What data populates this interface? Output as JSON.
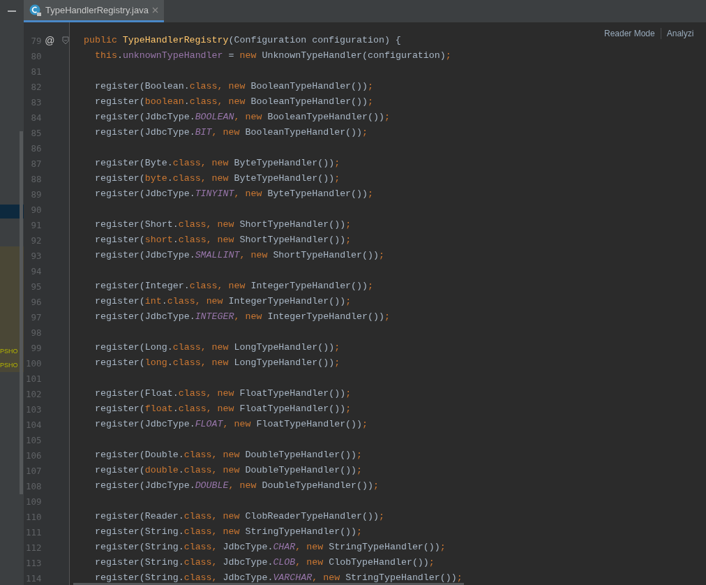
{
  "tab": {
    "title": "TypeHandlerRegistry.java",
    "selected": true
  },
  "left_panel": {
    "rows": [
      {
        "text": "PSHO"
      },
      {
        "text": "PSHO"
      }
    ]
  },
  "editor_toolbar": [
    "Reader Mode",
    "Analyzi"
  ],
  "lines": [
    {
      "number": "79",
      "kind": "signature",
      "gutter_mark": "@",
      "foldable": true,
      "tokens": [
        {
          "kind": "k",
          "text": "public"
        },
        {
          "kind": "d",
          "text": " TypeHandlerRegistry"
        },
        {
          "kind": "p",
          "text": "(Configuration configuration) {"
        }
      ]
    },
    {
      "number": "80",
      "kind": "body",
      "tokens": [
        {
          "kind": "k",
          "text": "this"
        },
        {
          "kind": "p",
          "text": "."
        },
        {
          "kind": "f",
          "text": "unknownTypeHandler"
        },
        {
          "kind": "p",
          "text": " = "
        },
        {
          "kind": "k",
          "text": "new"
        },
        {
          "kind": "p",
          "text": " UnknownTypeHandler(configuration)"
        },
        {
          "kind": "k",
          "text": ";"
        }
      ]
    },
    {
      "number": "81",
      "kind": "body"
    },
    {
      "number": "82",
      "kind": "body",
      "tokens": [
        {
          "kind": "p",
          "text": "register(Boolean."
        },
        {
          "kind": "k",
          "text": "class"
        },
        {
          "kind": "k",
          "text": ", "
        },
        {
          "kind": "k",
          "text": "new"
        },
        {
          "kind": "p",
          "text": " BooleanTypeHandler())"
        },
        {
          "kind": "k",
          "text": ";"
        }
      ]
    },
    {
      "number": "83",
      "kind": "body",
      "tokens": [
        {
          "kind": "p",
          "text": "register("
        },
        {
          "kind": "k",
          "text": "boolean"
        },
        {
          "kind": "p",
          "text": "."
        },
        {
          "kind": "k",
          "text": "class"
        },
        {
          "kind": "k",
          "text": ", "
        },
        {
          "kind": "k",
          "text": "new"
        },
        {
          "kind": "p",
          "text": " BooleanTypeHandler())"
        },
        {
          "kind": "k",
          "text": ";"
        }
      ]
    },
    {
      "number": "84",
      "kind": "body",
      "tokens": [
        {
          "kind": "p",
          "text": "register(JdbcType."
        },
        {
          "kind": "c",
          "text": "BOOLEAN"
        },
        {
          "kind": "k",
          "text": ", "
        },
        {
          "kind": "k",
          "text": "new"
        },
        {
          "kind": "p",
          "text": " BooleanTypeHandler())"
        },
        {
          "kind": "k",
          "text": ";"
        }
      ]
    },
    {
      "number": "85",
      "kind": "body",
      "tokens": [
        {
          "kind": "p",
          "text": "register(JdbcType."
        },
        {
          "kind": "c",
          "text": "BIT"
        },
        {
          "kind": "k",
          "text": ", "
        },
        {
          "kind": "k",
          "text": "new"
        },
        {
          "kind": "p",
          "text": " BooleanTypeHandler())"
        },
        {
          "kind": "k",
          "text": ";"
        }
      ]
    },
    {
      "number": "86",
      "kind": "body"
    },
    {
      "number": "87",
      "kind": "body",
      "tokens": [
        {
          "kind": "p",
          "text": "register(Byte."
        },
        {
          "kind": "k",
          "text": "class"
        },
        {
          "kind": "k",
          "text": ", "
        },
        {
          "kind": "k",
          "text": "new"
        },
        {
          "kind": "p",
          "text": " ByteTypeHandler())"
        },
        {
          "kind": "k",
          "text": ";"
        }
      ]
    },
    {
      "number": "88",
      "kind": "body",
      "tokens": [
        {
          "kind": "p",
          "text": "register("
        },
        {
          "kind": "k",
          "text": "byte"
        },
        {
          "kind": "p",
          "text": "."
        },
        {
          "kind": "k",
          "text": "class"
        },
        {
          "kind": "k",
          "text": ", "
        },
        {
          "kind": "k",
          "text": "new"
        },
        {
          "kind": "p",
          "text": " ByteTypeHandler())"
        },
        {
          "kind": "k",
          "text": ";"
        }
      ]
    },
    {
      "number": "89",
      "kind": "body",
      "tokens": [
        {
          "kind": "p",
          "text": "register(JdbcType."
        },
        {
          "kind": "c",
          "text": "TINYINT"
        },
        {
          "kind": "k",
          "text": ", "
        },
        {
          "kind": "k",
          "text": "new"
        },
        {
          "kind": "p",
          "text": " ByteTypeHandler())"
        },
        {
          "kind": "k",
          "text": ";"
        }
      ]
    },
    {
      "number": "90",
      "kind": "body"
    },
    {
      "number": "91",
      "kind": "body",
      "tokens": [
        {
          "kind": "p",
          "text": "register(Short."
        },
        {
          "kind": "k",
          "text": "class"
        },
        {
          "kind": "k",
          "text": ", "
        },
        {
          "kind": "k",
          "text": "new"
        },
        {
          "kind": "p",
          "text": " ShortTypeHandler())"
        },
        {
          "kind": "k",
          "text": ";"
        }
      ]
    },
    {
      "number": "92",
      "kind": "body",
      "tokens": [
        {
          "kind": "p",
          "text": "register("
        },
        {
          "kind": "k",
          "text": "short"
        },
        {
          "kind": "p",
          "text": "."
        },
        {
          "kind": "k",
          "text": "class"
        },
        {
          "kind": "k",
          "text": ", "
        },
        {
          "kind": "k",
          "text": "new"
        },
        {
          "kind": "p",
          "text": " ShortTypeHandler())"
        },
        {
          "kind": "k",
          "text": ";"
        }
      ]
    },
    {
      "number": "93",
      "kind": "body",
      "tokens": [
        {
          "kind": "p",
          "text": "register(JdbcType."
        },
        {
          "kind": "c",
          "text": "SMALLINT"
        },
        {
          "kind": "k",
          "text": ", "
        },
        {
          "kind": "k",
          "text": "new"
        },
        {
          "kind": "p",
          "text": " ShortTypeHandler())"
        },
        {
          "kind": "k",
          "text": ";"
        }
      ]
    },
    {
      "number": "94",
      "kind": "body"
    },
    {
      "number": "95",
      "kind": "body",
      "tokens": [
        {
          "kind": "p",
          "text": "register(Integer."
        },
        {
          "kind": "k",
          "text": "class"
        },
        {
          "kind": "k",
          "text": ", "
        },
        {
          "kind": "k",
          "text": "new"
        },
        {
          "kind": "p",
          "text": " IntegerTypeHandler())"
        },
        {
          "kind": "k",
          "text": ";"
        }
      ]
    },
    {
      "number": "96",
      "kind": "body",
      "tokens": [
        {
          "kind": "p",
          "text": "register("
        },
        {
          "kind": "k",
          "text": "int"
        },
        {
          "kind": "p",
          "text": "."
        },
        {
          "kind": "k",
          "text": "class"
        },
        {
          "kind": "k",
          "text": ", "
        },
        {
          "kind": "k",
          "text": "new"
        },
        {
          "kind": "p",
          "text": " IntegerTypeHandler())"
        },
        {
          "kind": "k",
          "text": ";"
        }
      ]
    },
    {
      "number": "97",
      "kind": "body",
      "tokens": [
        {
          "kind": "p",
          "text": "register(JdbcType."
        },
        {
          "kind": "c",
          "text": "INTEGER"
        },
        {
          "kind": "k",
          "text": ", "
        },
        {
          "kind": "k",
          "text": "new"
        },
        {
          "kind": "p",
          "text": " IntegerTypeHandler())"
        },
        {
          "kind": "k",
          "text": ";"
        }
      ]
    },
    {
      "number": "98",
      "kind": "body"
    },
    {
      "number": "99",
      "kind": "body",
      "tokens": [
        {
          "kind": "p",
          "text": "register(Long."
        },
        {
          "kind": "k",
          "text": "class"
        },
        {
          "kind": "k",
          "text": ", "
        },
        {
          "kind": "k",
          "text": "new"
        },
        {
          "kind": "p",
          "text": " LongTypeHandler())"
        },
        {
          "kind": "k",
          "text": ";"
        }
      ]
    },
    {
      "number": "100",
      "kind": "body",
      "tokens": [
        {
          "kind": "p",
          "text": "register("
        },
        {
          "kind": "k",
          "text": "long"
        },
        {
          "kind": "p",
          "text": "."
        },
        {
          "kind": "k",
          "text": "class"
        },
        {
          "kind": "k",
          "text": ", "
        },
        {
          "kind": "k",
          "text": "new"
        },
        {
          "kind": "p",
          "text": " LongTypeHandler())"
        },
        {
          "kind": "k",
          "text": ";"
        }
      ]
    },
    {
      "number": "101",
      "kind": "body"
    },
    {
      "number": "102",
      "kind": "body",
      "tokens": [
        {
          "kind": "p",
          "text": "register(Float."
        },
        {
          "kind": "k",
          "text": "class"
        },
        {
          "kind": "k",
          "text": ", "
        },
        {
          "kind": "k",
          "text": "new"
        },
        {
          "kind": "p",
          "text": " FloatTypeHandler())"
        },
        {
          "kind": "k",
          "text": ";"
        }
      ]
    },
    {
      "number": "103",
      "kind": "body",
      "tokens": [
        {
          "kind": "p",
          "text": "register("
        },
        {
          "kind": "k",
          "text": "float"
        },
        {
          "kind": "p",
          "text": "."
        },
        {
          "kind": "k",
          "text": "class"
        },
        {
          "kind": "k",
          "text": ", "
        },
        {
          "kind": "k",
          "text": "new"
        },
        {
          "kind": "p",
          "text": " FloatTypeHandler())"
        },
        {
          "kind": "k",
          "text": ";"
        }
      ]
    },
    {
      "number": "104",
      "kind": "body",
      "tokens": [
        {
          "kind": "p",
          "text": "register(JdbcType."
        },
        {
          "kind": "c",
          "text": "FLOAT"
        },
        {
          "kind": "k",
          "text": ", "
        },
        {
          "kind": "k",
          "text": "new"
        },
        {
          "kind": "p",
          "text": " FloatTypeHandler())"
        },
        {
          "kind": "k",
          "text": ";"
        }
      ]
    },
    {
      "number": "105",
      "kind": "body"
    },
    {
      "number": "106",
      "kind": "body",
      "tokens": [
        {
          "kind": "p",
          "text": "register(Double."
        },
        {
          "kind": "k",
          "text": "class"
        },
        {
          "kind": "k",
          "text": ", "
        },
        {
          "kind": "k",
          "text": "new"
        },
        {
          "kind": "p",
          "text": " DoubleTypeHandler())"
        },
        {
          "kind": "k",
          "text": ";"
        }
      ]
    },
    {
      "number": "107",
      "kind": "body",
      "tokens": [
        {
          "kind": "p",
          "text": "register("
        },
        {
          "kind": "k",
          "text": "double"
        },
        {
          "kind": "p",
          "text": "."
        },
        {
          "kind": "k",
          "text": "class"
        },
        {
          "kind": "k",
          "text": ", "
        },
        {
          "kind": "k",
          "text": "new"
        },
        {
          "kind": "p",
          "text": " DoubleTypeHandler())"
        },
        {
          "kind": "k",
          "text": ";"
        }
      ]
    },
    {
      "number": "108",
      "kind": "body",
      "tokens": [
        {
          "kind": "p",
          "text": "register(JdbcType."
        },
        {
          "kind": "c",
          "text": "DOUBLE"
        },
        {
          "kind": "k",
          "text": ", "
        },
        {
          "kind": "k",
          "text": "new"
        },
        {
          "kind": "p",
          "text": " DoubleTypeHandler())"
        },
        {
          "kind": "k",
          "text": ";"
        }
      ]
    },
    {
      "number": "109",
      "kind": "body"
    },
    {
      "number": "110",
      "kind": "body",
      "tokens": [
        {
          "kind": "p",
          "text": "register(Reader."
        },
        {
          "kind": "k",
          "text": "class"
        },
        {
          "kind": "k",
          "text": ", "
        },
        {
          "kind": "k",
          "text": "new"
        },
        {
          "kind": "p",
          "text": " ClobReaderTypeHandler())"
        },
        {
          "kind": "k",
          "text": ";"
        }
      ]
    },
    {
      "number": "111",
      "kind": "body",
      "tokens": [
        {
          "kind": "p",
          "text": "register(String."
        },
        {
          "kind": "k",
          "text": "class"
        },
        {
          "kind": "k",
          "text": ", "
        },
        {
          "kind": "k",
          "text": "new"
        },
        {
          "kind": "p",
          "text": " StringTypeHandler())"
        },
        {
          "kind": "k",
          "text": ";"
        }
      ]
    },
    {
      "number": "112",
      "kind": "body",
      "tokens": [
        {
          "kind": "p",
          "text": "register(String."
        },
        {
          "kind": "k",
          "text": "class"
        },
        {
          "kind": "k",
          "text": ", "
        },
        {
          "kind": "p",
          "text": "JdbcType."
        },
        {
          "kind": "c",
          "text": "CHAR"
        },
        {
          "kind": "k",
          "text": ", "
        },
        {
          "kind": "k",
          "text": "new"
        },
        {
          "kind": "p",
          "text": " StringTypeHandler())"
        },
        {
          "kind": "k",
          "text": ";"
        }
      ]
    },
    {
      "number": "113",
      "kind": "body",
      "tokens": [
        {
          "kind": "p",
          "text": "register(String."
        },
        {
          "kind": "k",
          "text": "class"
        },
        {
          "kind": "k",
          "text": ", "
        },
        {
          "kind": "p",
          "text": "JdbcType."
        },
        {
          "kind": "c",
          "text": "CLOB"
        },
        {
          "kind": "k",
          "text": ", "
        },
        {
          "kind": "k",
          "text": "new"
        },
        {
          "kind": "p",
          "text": " ClobTypeHandler())"
        },
        {
          "kind": "k",
          "text": ";"
        }
      ]
    },
    {
      "number": "114",
      "kind": "body",
      "tokens": [
        {
          "kind": "p",
          "text": "register(String."
        },
        {
          "kind": "k",
          "text": "class"
        },
        {
          "kind": "k",
          "text": ", "
        },
        {
          "kind": "p",
          "text": "JdbcType."
        },
        {
          "kind": "c",
          "text": "VARCHAR"
        },
        {
          "kind": "k",
          "text": ", "
        },
        {
          "kind": "k",
          "text": "new"
        },
        {
          "kind": "p",
          "text": " StringTypeHandler())"
        },
        {
          "kind": "k",
          "text": ";"
        }
      ]
    }
  ]
}
